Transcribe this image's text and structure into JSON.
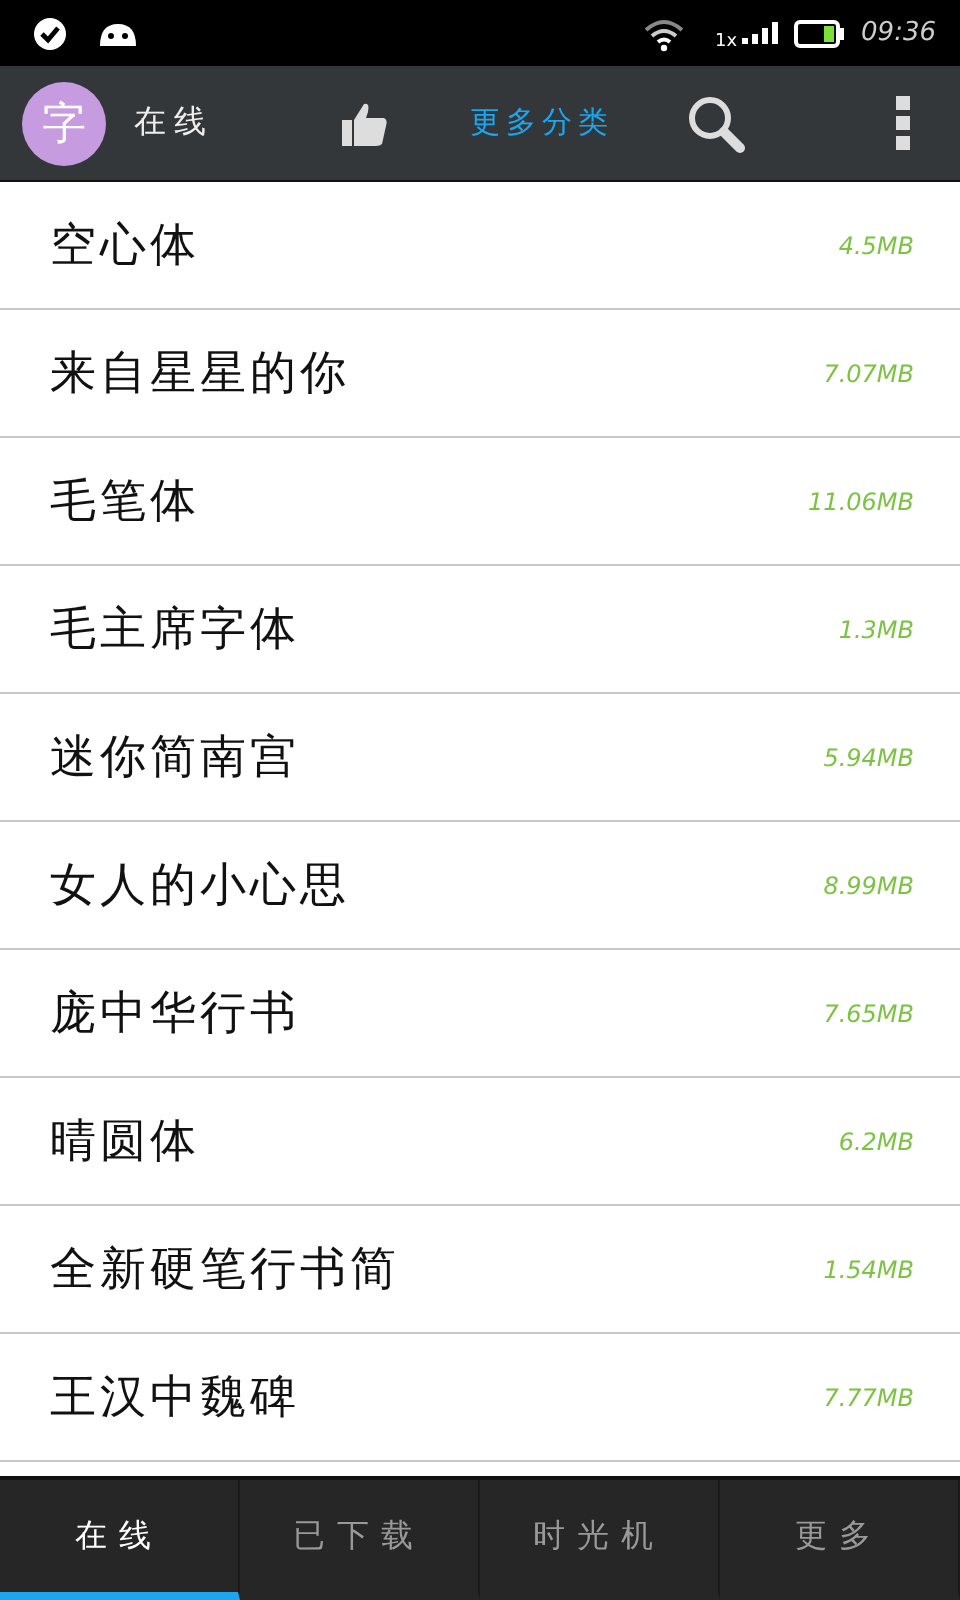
{
  "status_bar": {
    "time": "09:36",
    "network": "1x"
  },
  "action_bar": {
    "avatar": "字",
    "title": "在线",
    "category_link": "更多分类"
  },
  "fonts": [
    {
      "name": "空心体",
      "size": "4.5MB"
    },
    {
      "name": "来自星星的你",
      "size": "7.07MB"
    },
    {
      "name": "毛笔体",
      "size": "11.06MB"
    },
    {
      "name": "毛主席字体",
      "size": "1.3MB"
    },
    {
      "name": "迷你简南宫",
      "size": "5.94MB"
    },
    {
      "name": "女人的小心思",
      "size": "8.99MB"
    },
    {
      "name": "庞中华行书",
      "size": "7.65MB"
    },
    {
      "name": "晴圆体",
      "size": "6.2MB"
    },
    {
      "name": "全新硬笔行书简",
      "size": "1.54MB"
    },
    {
      "name": "王汉中魏碑",
      "size": "7.77MB"
    }
  ],
  "tabs": [
    {
      "label": "在线",
      "selected": true
    },
    {
      "label": "已下载",
      "selected": false
    },
    {
      "label": "时光机",
      "selected": false
    },
    {
      "label": "更多",
      "selected": false
    }
  ]
}
